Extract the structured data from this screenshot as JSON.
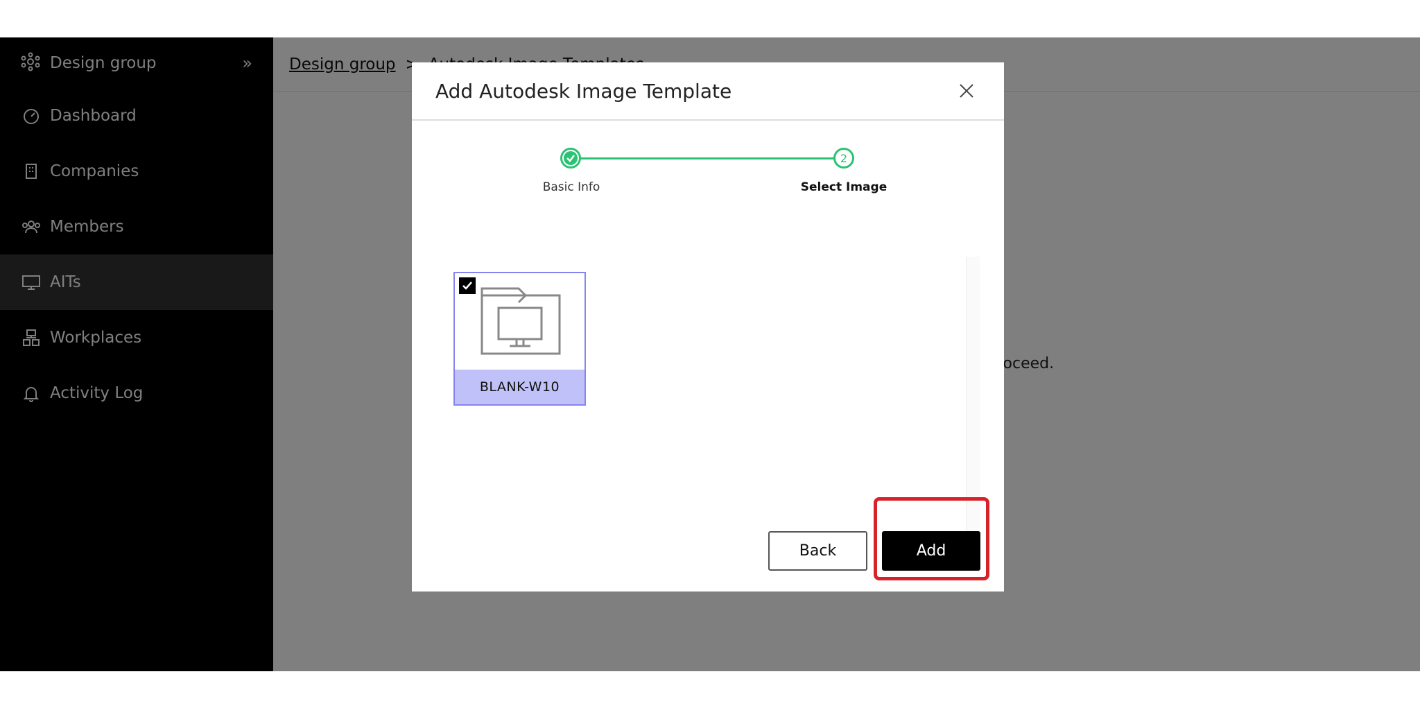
{
  "sidebar": {
    "header_label": "Design group",
    "collapse_glyph": "»",
    "items": [
      {
        "label": "Dashboard",
        "icon": "gauge-icon",
        "active": false
      },
      {
        "label": "Companies",
        "icon": "building-icon",
        "active": false
      },
      {
        "label": "Members",
        "icon": "members-icon",
        "active": false
      },
      {
        "label": "AITs",
        "icon": "monitor-icon",
        "active": true
      },
      {
        "label": "Workplaces",
        "icon": "workplaces-icon",
        "active": false
      },
      {
        "label": "Activity Log",
        "icon": "bell-icon",
        "active": false
      }
    ]
  },
  "breadcrumb": {
    "link": "Design group",
    "separator": ">",
    "current": "Autodesk Image Templates"
  },
  "background_message": "proceed.",
  "modal": {
    "title": "Add Autodesk Image Template",
    "steps": [
      {
        "label": "Basic Info",
        "state": "complete"
      },
      {
        "label": "Select Image",
        "state": "current",
        "number": "2"
      }
    ],
    "images": [
      {
        "name": "BLANK-W10",
        "selected": true
      }
    ],
    "back_label": "Back",
    "add_label": "Add"
  },
  "colors": {
    "accent_green": "#2bc275",
    "selection_border": "#8585f0",
    "selection_fill": "#c1c1f9",
    "highlight_red": "#d8222b"
  }
}
